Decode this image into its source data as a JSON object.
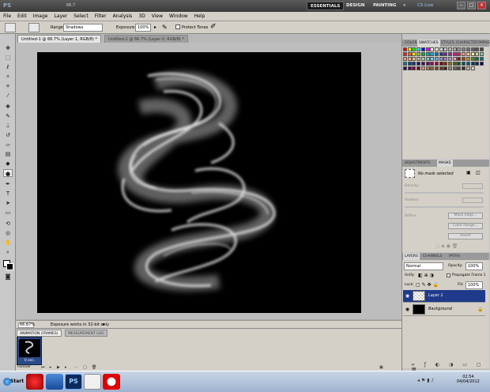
{
  "app": {
    "logo": "PS",
    "zoom": "66.7",
    "workspaces": [
      "ESSENTIALS",
      "DESIGN",
      "PAINTING"
    ],
    "more": "»",
    "cslive": "CS Live",
    "window_buttons": [
      "–",
      "□",
      "×"
    ]
  },
  "menu": [
    "File",
    "Edit",
    "Image",
    "Layer",
    "Select",
    "Filter",
    "Analysis",
    "3D",
    "View",
    "Window",
    "Help"
  ],
  "options": {
    "range_label": "Range:",
    "range_value": "Shadows",
    "exposure_label": "Exposure:",
    "exposure_value": "100%",
    "protect_tones": "Protect Tones"
  },
  "doc_tabs": [
    "Untitled-1 @ 66.7% (Layer 1, RGB/8) *",
    "Untitled-2 @ 66.7% (Layer 0, RGB/8) *"
  ],
  "status": {
    "zoom": "66.67%",
    "message": "Exposure works in 32-bit only"
  },
  "animation": {
    "tabs": [
      "ANIMATION (FRAMES)",
      "MEASUREMENT LOG"
    ],
    "frame_number": "1",
    "frame_duration": "0 sec.",
    "loop": "Forever"
  },
  "panels": {
    "swatch_tabs": [
      "COLOR",
      "SWATCHES",
      "STYLES",
      "CHARACTER",
      "PARAGRAPH"
    ],
    "adjust_tabs": [
      "ADJUSTMENTS",
      "MASKS"
    ],
    "masks": {
      "title": "No mask selected",
      "density": "Density:",
      "feather": "Feather:",
      "refine": "Refine:",
      "buttons": [
        "Mask Edge...",
        "Color Range...",
        "Invert"
      ]
    },
    "layers_tabs": [
      "LAYERS",
      "CHANNELS",
      "PATHS"
    ],
    "blend_mode": "Normal",
    "opacity_label": "Opacity:",
    "opacity": "100%",
    "unify_label": "Unify:",
    "propagate": "Propagate Frame 1",
    "lock_label": "Lock:",
    "fill_label": "Fill:",
    "fill": "100%",
    "layers": [
      {
        "name": "Layer 1",
        "selected": true
      },
      {
        "name": "Background",
        "selected": false
      }
    ]
  },
  "swatch_colors": [
    "#ff0000",
    "#ffff00",
    "#00ff00",
    "#00ffff",
    "#0000ff",
    "#ff00ff",
    "#ffffff",
    "#eeeeee",
    "#dddddd",
    "#cccccc",
    "#bbbbbb",
    "#aaaaaa",
    "#999999",
    "#888888",
    "#777777",
    "#666666",
    "#555555",
    "#444444",
    "#ed1c24",
    "#f26522",
    "#fff200",
    "#8dc63f",
    "#00a651",
    "#00a99d",
    "#00aeef",
    "#0072bc",
    "#2e3192",
    "#662d91",
    "#92278f",
    "#ec008c",
    "#ed145b",
    "#f7977a",
    "#fdc68a",
    "#fff799",
    "#c4df9b",
    "#82ca9c",
    "#f69679",
    "#f9ad81",
    "#fbc08a",
    "#c7b299",
    "#a3d39c",
    "#7accc8",
    "#6dcff6",
    "#7da7d9",
    "#8393ca",
    "#a187be",
    "#bd8cbf",
    "#f49ac1",
    "#9e0b0f",
    "#a0410d",
    "#aba000",
    "#598527",
    "#007236",
    "#00746b",
    "#0076a3",
    "#004a80",
    "#003471",
    "#1b1464",
    "#440e62",
    "#630460",
    "#9e005d",
    "#9e0039",
    "#790000",
    "#7b2e00",
    "#827b00",
    "#406618",
    "#005e20",
    "#005952",
    "#005b7f",
    "#003663",
    "#002157",
    "#0d004c",
    "#32004b",
    "#4b0049",
    "#7b0046",
    "#7a0026",
    "#c69c6d",
    "#a67c52",
    "#8c6239",
    "#754c24",
    "#603813",
    "#42210b",
    "#998675",
    "#736357",
    "#534741",
    "#362f2d",
    "#c7b299",
    "#e4d0b8"
  ],
  "taskbar": {
    "start": "Start",
    "time": "02:54",
    "date": "04/04/2012"
  }
}
